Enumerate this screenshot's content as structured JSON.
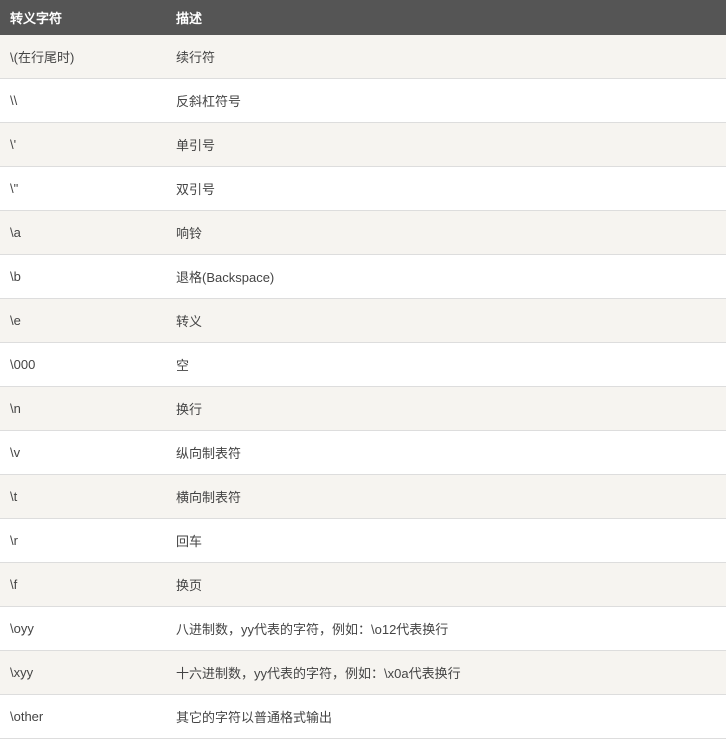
{
  "table": {
    "headers": [
      "转义字符",
      "描述"
    ],
    "rows": [
      {
        "char": "\\(在行尾时)",
        "desc": "续行符"
      },
      {
        "char": "\\\\",
        "desc": "反斜杠符号"
      },
      {
        "char": "\\'",
        "desc": "单引号"
      },
      {
        "char": "\\\"",
        "desc": "双引号"
      },
      {
        "char": "\\a",
        "desc": "响铃"
      },
      {
        "char": "\\b",
        "desc": "退格(Backspace)"
      },
      {
        "char": "\\e",
        "desc": "转义"
      },
      {
        "char": "\\000",
        "desc": "空"
      },
      {
        "char": "\\n",
        "desc": "换行"
      },
      {
        "char": "\\v",
        "desc": "纵向制表符"
      },
      {
        "char": "\\t",
        "desc": "横向制表符"
      },
      {
        "char": "\\r",
        "desc": "回车"
      },
      {
        "char": "\\f",
        "desc": "换页"
      },
      {
        "char": "\\oyy",
        "desc": "八进制数，yy代表的字符，例如：\\o12代表换行"
      },
      {
        "char": "\\xyy",
        "desc": "十六进制数，yy代表的字符，例如：\\x0a代表换行"
      },
      {
        "char": "\\other",
        "desc": "其它的字符以普通格式输出"
      }
    ]
  }
}
